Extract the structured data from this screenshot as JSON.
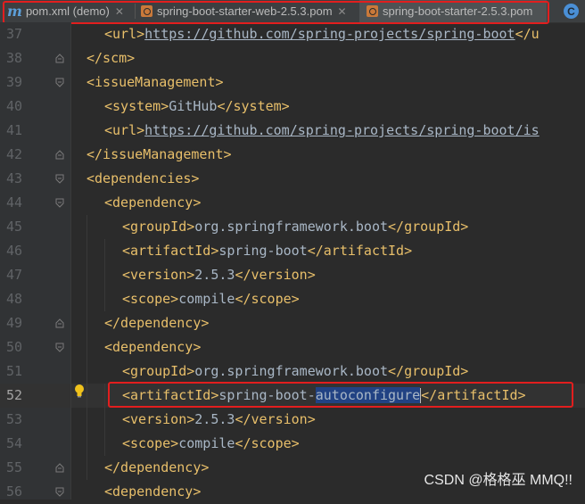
{
  "tabs": [
    {
      "label": "pom.xml (demo)",
      "icon": "maven-icon",
      "active": false
    },
    {
      "label": "spring-boot-starter-web-2.5.3.pom",
      "icon": "xml-file-icon",
      "active": false
    },
    {
      "label": "spring-boot-starter-2.5.3.pom",
      "icon": "xml-file-icon",
      "active": true
    }
  ],
  "tab_overflow_icon": "class-file-icon",
  "tab_overflow_letter": "C",
  "colors": {
    "tag": "#e8bf6a",
    "text": "#a9b7c6",
    "selection": "#214283",
    "annotation": "#e21e1e",
    "background": "#2b2b2b"
  },
  "lines": [
    {
      "num": "37",
      "indent": 1,
      "parts": [
        [
          "tag",
          "<url>"
        ],
        [
          "url",
          "https://github.com/spring-projects/spring-boot"
        ],
        [
          "tag",
          "</u"
        ]
      ]
    },
    {
      "num": "38",
      "indent": 0,
      "parts": [
        [
          "tag",
          "</scm>"
        ]
      ]
    },
    {
      "num": "39",
      "indent": 0,
      "parts": [
        [
          "tag",
          "<issueManagement>"
        ]
      ]
    },
    {
      "num": "40",
      "indent": 1,
      "parts": [
        [
          "tag",
          "<system>"
        ],
        [
          "text",
          "GitHub"
        ],
        [
          "tag",
          "</system>"
        ]
      ]
    },
    {
      "num": "41",
      "indent": 1,
      "parts": [
        [
          "tag",
          "<url>"
        ],
        [
          "url",
          "https://github.com/spring-projects/spring-boot/is"
        ]
      ]
    },
    {
      "num": "42",
      "indent": 0,
      "parts": [
        [
          "tag",
          "</issueManagement>"
        ]
      ]
    },
    {
      "num": "43",
      "indent": 0,
      "parts": [
        [
          "tag",
          "<dependencies>"
        ]
      ]
    },
    {
      "num": "44",
      "indent": 1,
      "parts": [
        [
          "tag",
          "<dependency>"
        ]
      ]
    },
    {
      "num": "45",
      "indent": 2,
      "parts": [
        [
          "tag",
          "<groupId>"
        ],
        [
          "text",
          "org.springframework.boot"
        ],
        [
          "tag",
          "</groupId>"
        ]
      ]
    },
    {
      "num": "46",
      "indent": 2,
      "parts": [
        [
          "tag",
          "<artifactId>"
        ],
        [
          "text",
          "spring-boot"
        ],
        [
          "tag",
          "</artifactId>"
        ]
      ]
    },
    {
      "num": "47",
      "indent": 2,
      "parts": [
        [
          "tag",
          "<version>"
        ],
        [
          "text",
          "2.5.3"
        ],
        [
          "tag",
          "</version>"
        ]
      ]
    },
    {
      "num": "48",
      "indent": 2,
      "parts": [
        [
          "tag",
          "<scope>"
        ],
        [
          "text",
          "compile"
        ],
        [
          "tag",
          "</scope>"
        ]
      ]
    },
    {
      "num": "49",
      "indent": 1,
      "parts": [
        [
          "tag",
          "</dependency>"
        ]
      ]
    },
    {
      "num": "50",
      "indent": 1,
      "parts": [
        [
          "tag",
          "<dependency>"
        ]
      ]
    },
    {
      "num": "51",
      "indent": 2,
      "parts": [
        [
          "tag",
          "<groupId>"
        ],
        [
          "text",
          "org.springframework.boot"
        ],
        [
          "tag",
          "</groupId>"
        ]
      ]
    },
    {
      "num": "52",
      "indent": 2,
      "current": true,
      "parts": [
        [
          "tag",
          "<artifactId>"
        ],
        [
          "text",
          "spring-boot-"
        ],
        [
          "sel",
          "autoconfigure"
        ],
        [
          "caret",
          ""
        ],
        [
          "tag",
          "</artifactId>"
        ]
      ]
    },
    {
      "num": "53",
      "indent": 2,
      "parts": [
        [
          "tag",
          "<version>"
        ],
        [
          "text",
          "2.5.3"
        ],
        [
          "tag",
          "</version>"
        ]
      ]
    },
    {
      "num": "54",
      "indent": 2,
      "parts": [
        [
          "tag",
          "<scope>"
        ],
        [
          "text",
          "compile"
        ],
        [
          "tag",
          "</scope>"
        ]
      ]
    },
    {
      "num": "55",
      "indent": 1,
      "parts": [
        [
          "tag",
          "</dependency>"
        ]
      ]
    },
    {
      "num": "56",
      "indent": 1,
      "parts": [
        [
          "tag",
          "<dependency>"
        ]
      ]
    }
  ],
  "folds": {
    "38": "end",
    "39": "start",
    "42": "end",
    "43": "start",
    "44": "start",
    "49": "end",
    "50": "start",
    "55": "end",
    "56": "start"
  },
  "intention_icon": "lightbulb-icon",
  "watermark": "CSDN @格格巫 MMQ!!"
}
